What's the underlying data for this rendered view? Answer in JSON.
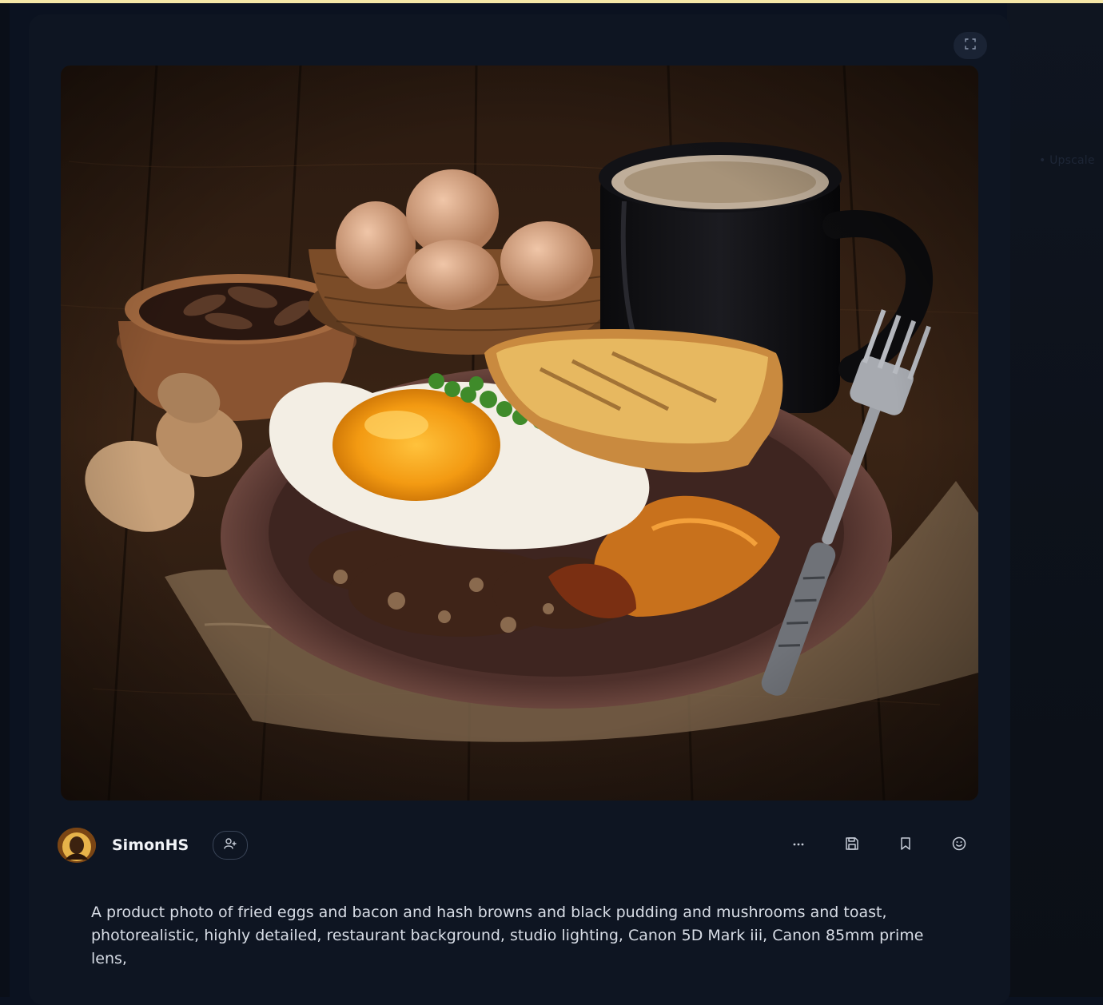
{
  "post": {
    "author": "SimonHS",
    "prompt": "A product photo of fried eggs and bacon and hash browns and black pudding and mushrooms and toast, photorealistic, highly detailed, restaurant background, studio lighting, Canon 5D Mark iii, Canon 85mm prime lens,"
  },
  "sidebar_faint": {
    "text": "• Upscale"
  },
  "icons": {
    "expand": "expand-icon",
    "follow": "user-plus-icon",
    "more": "more-icon",
    "save": "save-icon",
    "bookmark": "bookmark-icon",
    "react": "smile-icon"
  },
  "colors": {
    "background": "#0b1220",
    "card": "#0e1522",
    "text": "#e6e9ef",
    "accent_strip": "#f6e7a7"
  }
}
